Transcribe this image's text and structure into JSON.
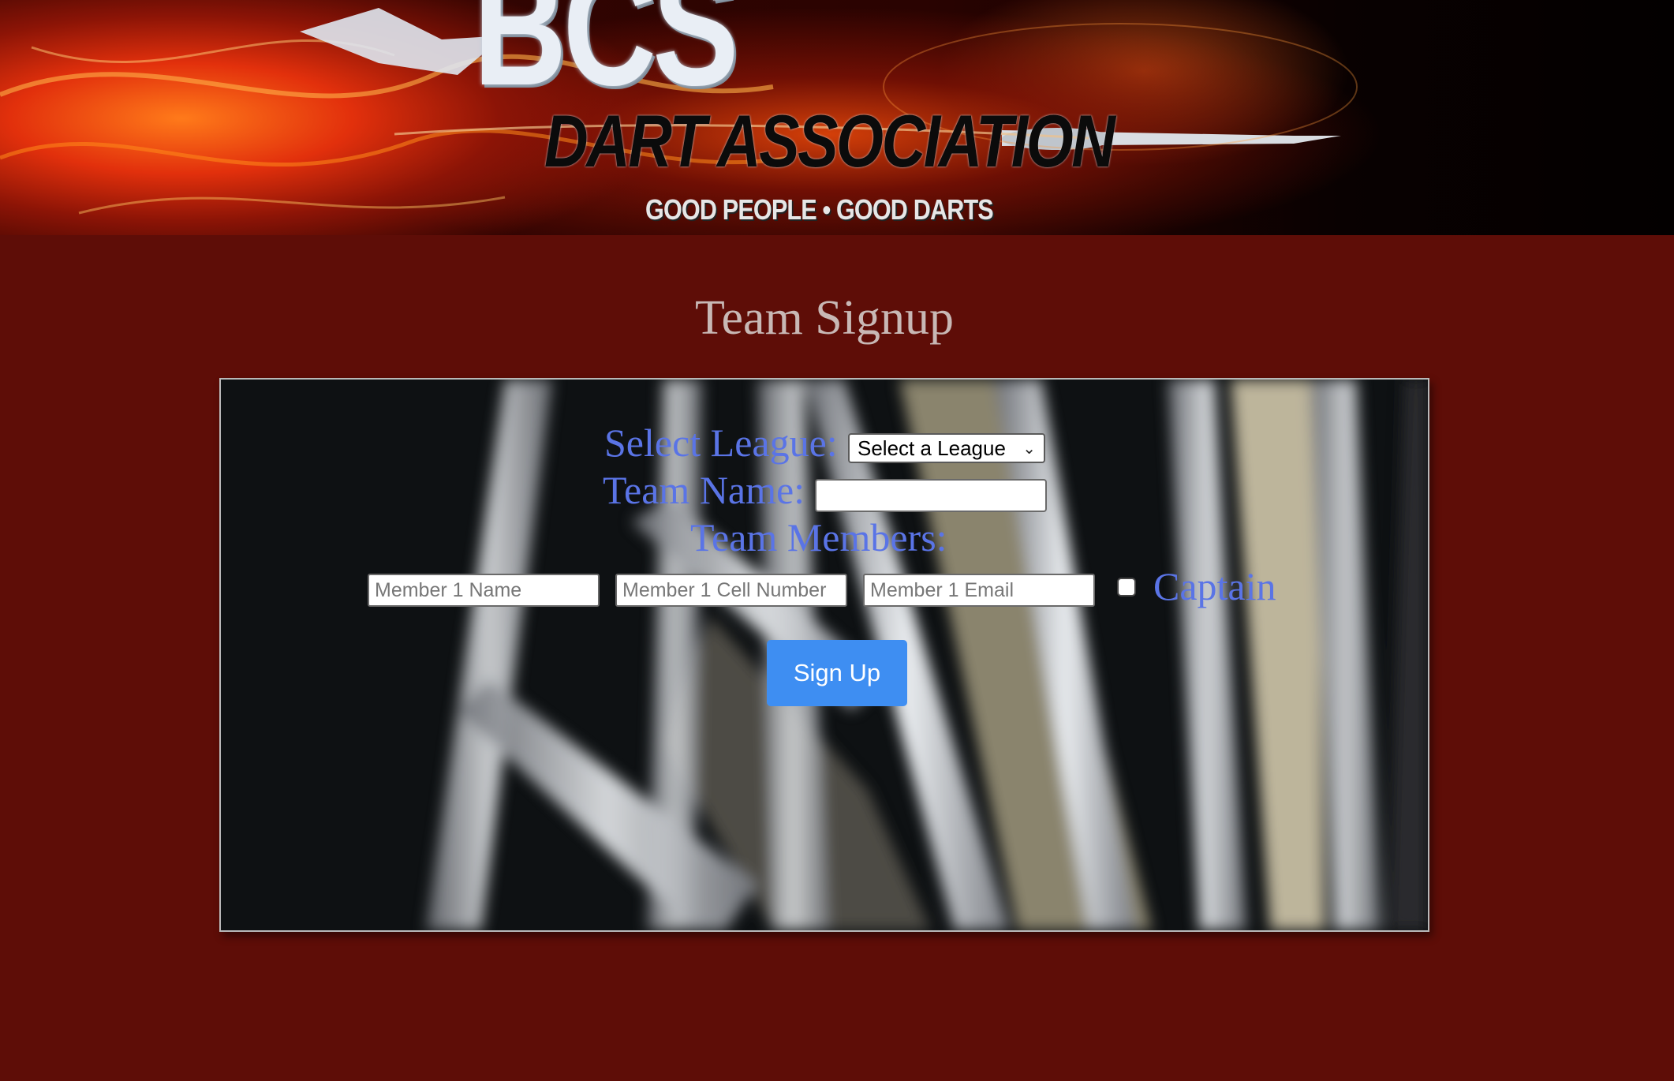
{
  "banner": {
    "logo_text": "BCS",
    "title": "DART ASSOCIATION",
    "tagline": "GOOD PEOPLE • GOOD DARTS"
  },
  "page": {
    "title": "Team Signup"
  },
  "form": {
    "league_label": "Select League:",
    "league_selected": "Select a League",
    "team_name_label": "Team Name:",
    "team_name_value": "",
    "members_label": "Team Members:",
    "member_name_placeholder": "Member 1 Name",
    "member_cell_placeholder": "Member 1 Cell Number",
    "member_email_placeholder": "Member 1 Email",
    "captain_label": "Captain",
    "captain_checked": false,
    "submit_label": "Sign Up"
  },
  "colors": {
    "page_background": "#5e0d07",
    "label_color": "#5a74e6",
    "title_color": "#c8b8b5",
    "button_color": "#3e8ef2"
  }
}
